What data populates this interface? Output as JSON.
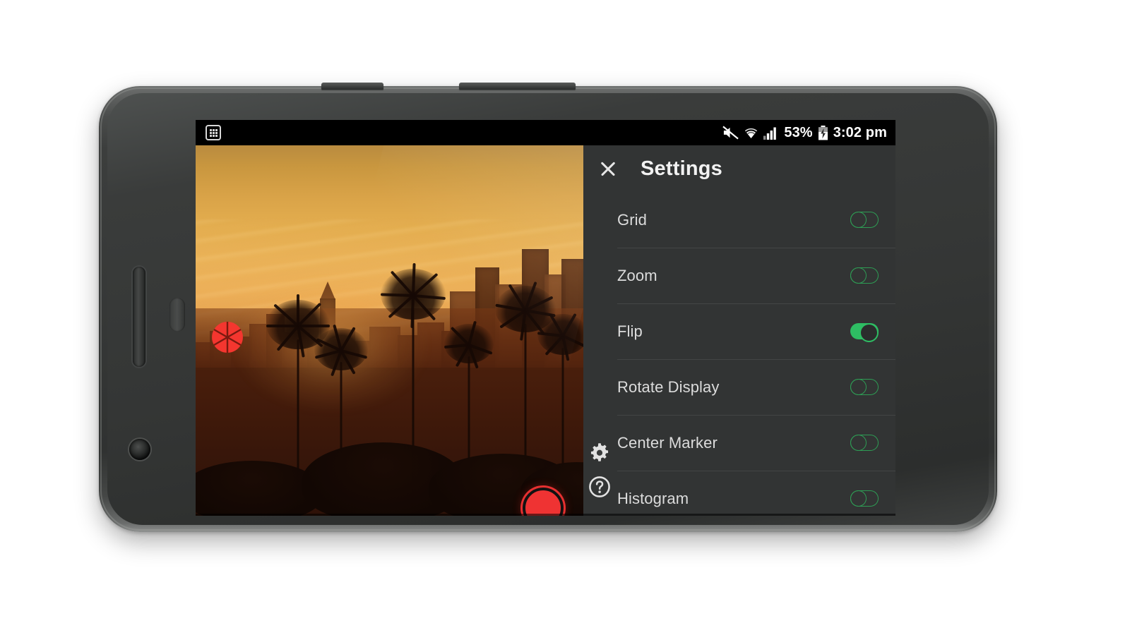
{
  "device": {
    "name": "android-smartphone-landscape",
    "orientation": "landscape"
  },
  "status_bar": {
    "notification_icon": "app-grid-icon",
    "icons": [
      "volume-muted-icon",
      "wifi-icon",
      "cellular-signal-icon"
    ],
    "battery_percent": "53%",
    "battery_icon": "battery-charging-icon",
    "time": "3:02 pm"
  },
  "viewfinder": {
    "scene_description": "Los Angeles downtown skyline at sunset with palm tree silhouettes",
    "aperture_badge_icon": "aperture-iris-icon",
    "shutter_button_label": "",
    "shutter_button_name": "shutter-record-button",
    "accent_red": "#ef3333"
  },
  "settings": {
    "title": "Settings",
    "close_label": "",
    "close_icon": "close-x-icon",
    "tools": [
      {
        "icon": "gear-icon",
        "name": "settings-gear-button"
      },
      {
        "icon": "help-circle-icon",
        "name": "help-button"
      }
    ],
    "toggle_on_color": "#2ebd63",
    "toggle_off_color": "#2e9c54",
    "panel_bg": "#323434",
    "rows": [
      {
        "label": "Grid",
        "state": "off"
      },
      {
        "label": "Zoom",
        "state": "off"
      },
      {
        "label": "Flip",
        "state": "on"
      },
      {
        "label": "Rotate Display",
        "state": "off"
      },
      {
        "label": "Center Marker",
        "state": "off"
      },
      {
        "label": "Histogram",
        "state": "off"
      }
    ]
  }
}
